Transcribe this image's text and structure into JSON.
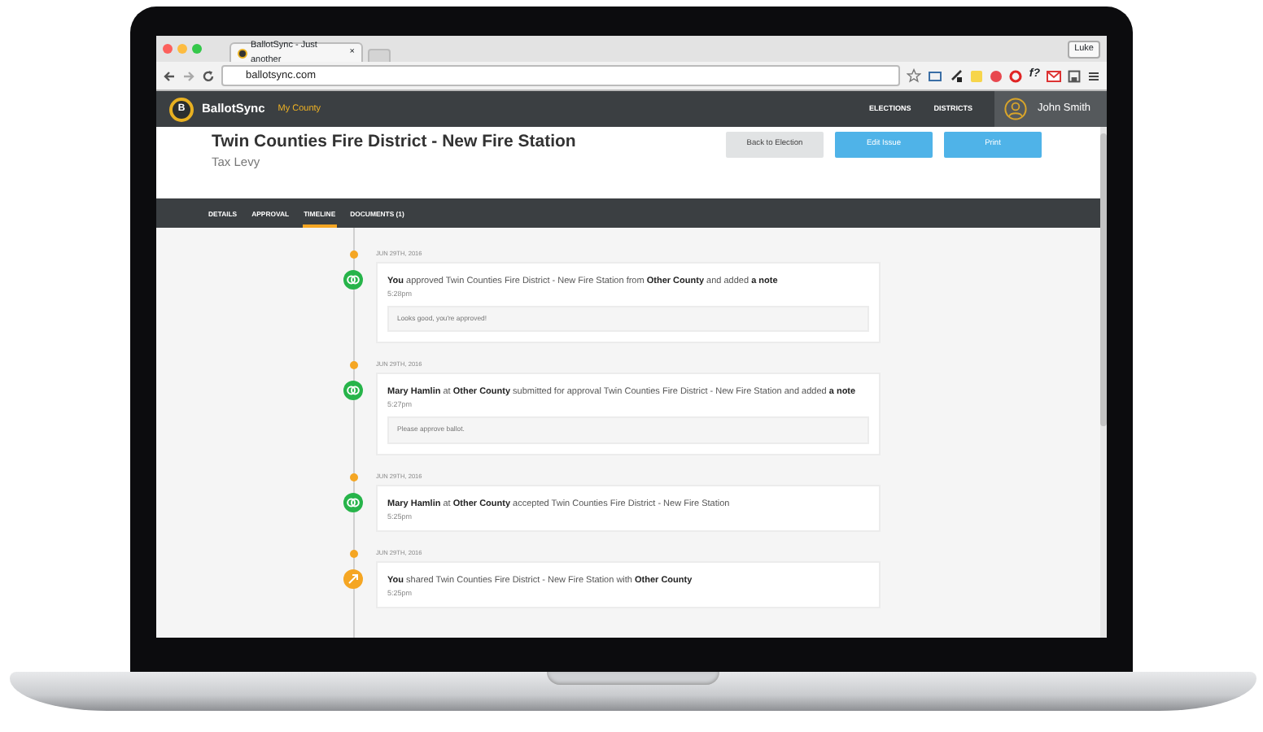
{
  "browser": {
    "tab_title": "BallotSync - Just another",
    "tab_close": "×",
    "profile": "Luke",
    "url": "ballotsync.com",
    "extension_text": "f?"
  },
  "navbar": {
    "logo_letter": "B",
    "brand": "BallotSync",
    "county": "My County",
    "links": [
      "ELECTIONS",
      "DISTRICTS"
    ],
    "user": "John Smith"
  },
  "header": {
    "title": "Twin Counties Fire District - New Fire Station",
    "subtitle": "Tax Levy",
    "buttons": [
      {
        "label": "Back to Election",
        "kind": "secondary"
      },
      {
        "label": "Edit Issue",
        "kind": "primary"
      },
      {
        "label": "Print",
        "kind": "primary"
      }
    ]
  },
  "tabs": [
    {
      "label": "DETAILS",
      "selected": false
    },
    {
      "label": "APPROVAL",
      "selected": false
    },
    {
      "label": "TIMELINE",
      "selected": true
    },
    {
      "label": "DOCUMENTS (1)",
      "selected": false
    }
  ],
  "timeline": [
    {
      "date": "JUN 29TH, 2016",
      "kind": "approval",
      "text": "**You** approved Twin Counties Fire District - New Fire Station from **Other County** and added **a note**",
      "time": "5:28pm",
      "note": "Looks good, you're approved!"
    },
    {
      "date": "JUN 29TH, 2016",
      "kind": "approval",
      "text": "**Mary Hamlin** at **Other County** submitted for approval Twin Counties Fire District - New Fire Station and added **a note**",
      "time": "5:27pm",
      "note": "Please approve ballot."
    },
    {
      "date": "JUN 29TH, 2016",
      "kind": "approval",
      "text": "**Mary Hamlin** at **Other County** accepted Twin Counties Fire District - New Fire Station",
      "time": "5:25pm"
    },
    {
      "date": "JUN 29TH, 2016",
      "kind": "share",
      "text": "**You** shared Twin Counties Fire District - New Fire Station with **Other County**",
      "time": "5:25pm"
    }
  ]
}
